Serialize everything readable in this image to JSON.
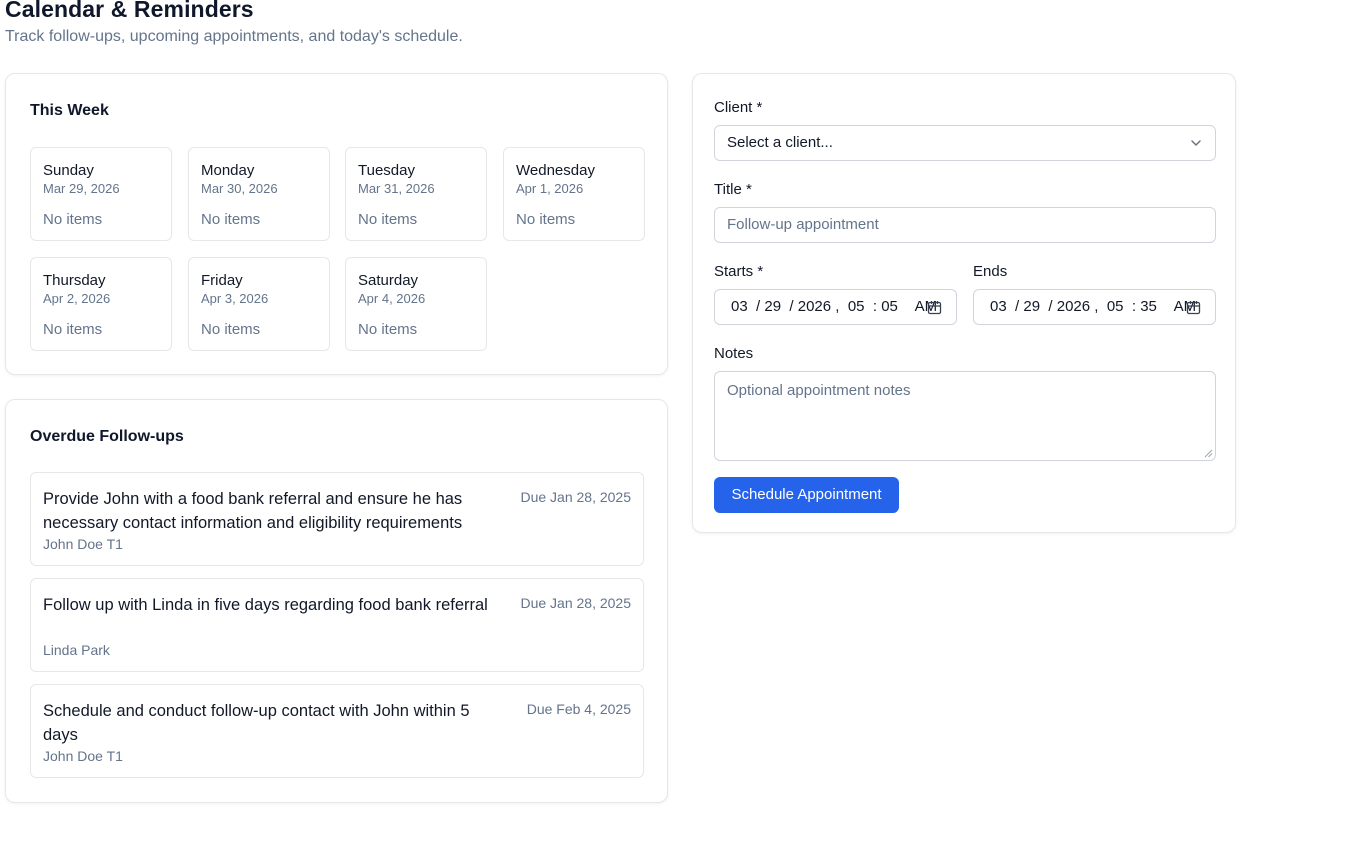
{
  "header": {
    "title": "Calendar & Reminders",
    "subtitle": "Track follow-ups, upcoming appointments, and today's schedule."
  },
  "week": {
    "title": "This Week",
    "days": [
      {
        "name": "Sunday",
        "date": "Mar 29, 2026",
        "empty": "No items"
      },
      {
        "name": "Monday",
        "date": "Mar 30, 2026",
        "empty": "No items"
      },
      {
        "name": "Tuesday",
        "date": "Mar 31, 2026",
        "empty": "No items"
      },
      {
        "name": "Wednesday",
        "date": "Apr 1, 2026",
        "empty": "No items"
      },
      {
        "name": "Thursday",
        "date": "Apr 2, 2026",
        "empty": "No items"
      },
      {
        "name": "Friday",
        "date": "Apr 3, 2026",
        "empty": "No items"
      },
      {
        "name": "Saturday",
        "date": "Apr 4, 2026",
        "empty": "No items"
      }
    ]
  },
  "overdue": {
    "title": "Overdue Follow-ups",
    "items": [
      {
        "title": "Provide John with a food bank referral and ensure he has necessary contact information and eligibility requirements",
        "client": "John Doe T1",
        "due": "Due Jan 28, 2025"
      },
      {
        "title": "Follow up with Linda in five days regarding food bank referral",
        "client": "Linda Park",
        "due": "Due Jan 28, 2025"
      },
      {
        "title": "Schedule and conduct follow-up contact with John within 5 days",
        "client": "John Doe T1",
        "due": "Due Feb 4, 2025"
      }
    ]
  },
  "form": {
    "client_label": "Client *",
    "client_value": "Select a client...",
    "title_label": "Title *",
    "title_placeholder": "Follow-up appointment",
    "starts_label": "Starts *",
    "starts": {
      "month": "03",
      "day": "29",
      "year": "2026",
      "hour": "05",
      "minute": "05",
      "ampm": "AM"
    },
    "ends_label": "Ends",
    "ends": {
      "month": "03",
      "day": "29",
      "year": "2026",
      "hour": "05",
      "minute": "35",
      "ampm": "AM"
    },
    "notes_label": "Notes",
    "notes_placeholder": "Optional appointment notes",
    "submit_label": "Schedule Appointment"
  },
  "colors": {
    "accent": "#2563eb",
    "muted_text": "#64748b",
    "border": "#e5e7eb"
  }
}
